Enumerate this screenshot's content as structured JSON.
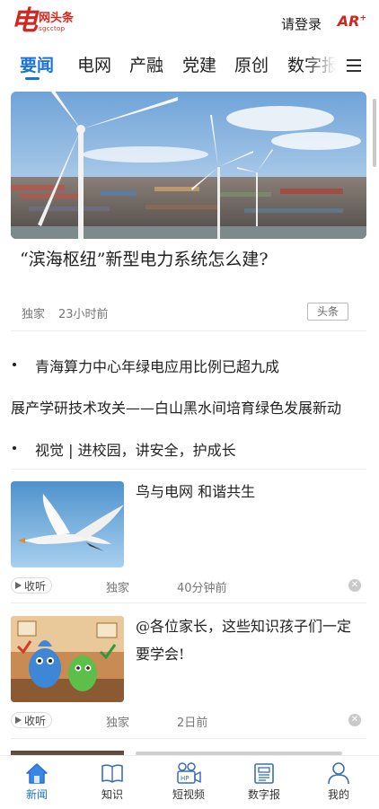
{
  "header": {
    "logo_mark": "电",
    "logo_name": "网头条",
    "logo_sub": "sgcctop",
    "login": "请登录",
    "ar_label": "AR",
    "ar_badge": "+"
  },
  "tabs": [
    {
      "label": "要闻",
      "active": true
    },
    {
      "label": "电网"
    },
    {
      "label": "产融"
    },
    {
      "label": "党建"
    },
    {
      "label": "原创"
    },
    {
      "label": "数字报"
    }
  ],
  "featured": {
    "title": "“滨海枢纽”新型电力系统怎么建?",
    "source": "独家",
    "time": "23小时前",
    "tag": "头条"
  },
  "headlines": [
    "青海算力中心年绿电应用比例已超九成",
    "展产学研技术攻关——白山黑水间培育绿色发展新动",
    "视觉 | 进校园，讲安全，护成长"
  ],
  "cards": [
    {
      "title": "鸟与电网  和谐共生",
      "listen": "收听",
      "source": "独家",
      "time": "40分钟前"
    },
    {
      "title": "@各位家长，这些知识孩子们一定要学会!",
      "listen": "收听",
      "source": "独家",
      "time": "2日前"
    }
  ],
  "bottom_nav": [
    {
      "label": "新闻",
      "icon": "home-icon",
      "active": true
    },
    {
      "label": "知识",
      "icon": "book-icon"
    },
    {
      "label": "短视频",
      "icon": "video-icon"
    },
    {
      "label": "数字报",
      "icon": "newspaper-icon"
    },
    {
      "label": "我的",
      "icon": "user-icon"
    }
  ],
  "colors": {
    "brand_red": "#d2271f",
    "accent_blue": "#1a73d9"
  }
}
